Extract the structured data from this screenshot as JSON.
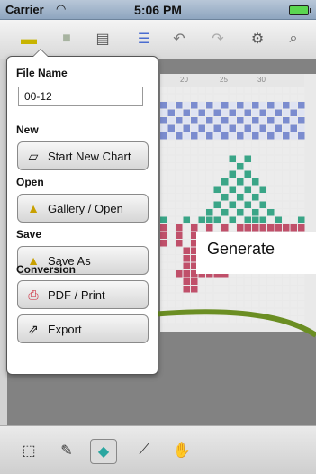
{
  "status": {
    "carrier": "Carrier",
    "time": "5:06 PM",
    "wifi_icon": "wifi-icon",
    "battery_icon": "battery-icon"
  },
  "toolbar": {
    "icons": [
      "folder-icon",
      "save-icon",
      "database-icon",
      "list-icon",
      "undo-icon",
      "redo-icon",
      "settings-icon",
      "zoom-icon"
    ]
  },
  "ruler": {
    "labels": [
      "20",
      "25",
      "30"
    ]
  },
  "popover": {
    "file_name_label": "File Name",
    "file_name_value": "00-12",
    "new_label": "New",
    "start_new_chart": "Start New Chart",
    "open_label": "Open",
    "gallery_open": "Gallery / Open",
    "save_label": "Save",
    "save_as": "Save As",
    "conversion_label": "Conversion",
    "pdf_print": "PDF / Print",
    "export": "Export"
  },
  "callout": {
    "text": "Generate"
  },
  "colors": {
    "accent_green": "#6b8e23",
    "chart_pink": "#c0506a",
    "chart_teal": "#3aa587",
    "chart_blue": "#7b8ccf"
  },
  "bottom": {
    "icons": [
      "select-icon",
      "eyedropper-icon",
      "fill-icon",
      "line-icon",
      "hand-icon"
    ]
  }
}
